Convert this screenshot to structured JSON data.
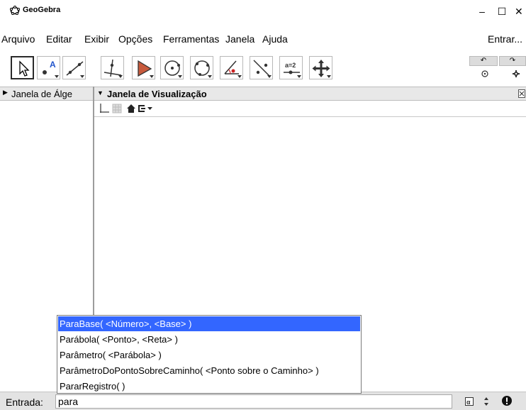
{
  "window": {
    "title": "GeoGebra",
    "controls": {
      "minimize": "–",
      "maximize": "☐",
      "close": "✕"
    }
  },
  "menu": {
    "items": [
      "Arquivo",
      "Editar",
      "Exibir",
      "Opções",
      "Ferramentas",
      "Janela",
      "Ajuda"
    ],
    "signin": "Entrar..."
  },
  "toolbar": {
    "tools": [
      {
        "icon": "move-pointer-icon"
      },
      {
        "icon": "point-icon",
        "label": "A"
      },
      {
        "icon": "line-icon"
      },
      {
        "icon": "perpendicular-line-icon"
      },
      {
        "icon": "polygon-icon"
      },
      {
        "icon": "circle-center-point-icon"
      },
      {
        "icon": "circle-three-points-icon"
      },
      {
        "icon": "angle-icon"
      },
      {
        "icon": "reflect-icon"
      },
      {
        "icon": "slider-icon",
        "label": "a=2"
      },
      {
        "icon": "move-view-icon"
      }
    ],
    "undo": "↶",
    "redo": "↷"
  },
  "algebra": {
    "title": "Janela de Álge"
  },
  "graphics": {
    "title": "Janela de Visualização"
  },
  "input": {
    "label": "Entrada:",
    "value": "para"
  },
  "autocomplete": {
    "items": [
      "ParaBase( <Número>, <Base> )",
      "Parábola( <Ponto>, <Reta> )",
      "Parâmetro( <Parábola> )",
      "ParâmetroDoPontoSobreCaminho( <Ponto sobre o Caminho> )",
      "PararRegistro( )"
    ],
    "selected_index": 0
  },
  "colors": {
    "selection": "#3366ff",
    "header": "#e8e8e8",
    "accent_red": "#cc2222",
    "accent_blue": "#2255cc"
  }
}
